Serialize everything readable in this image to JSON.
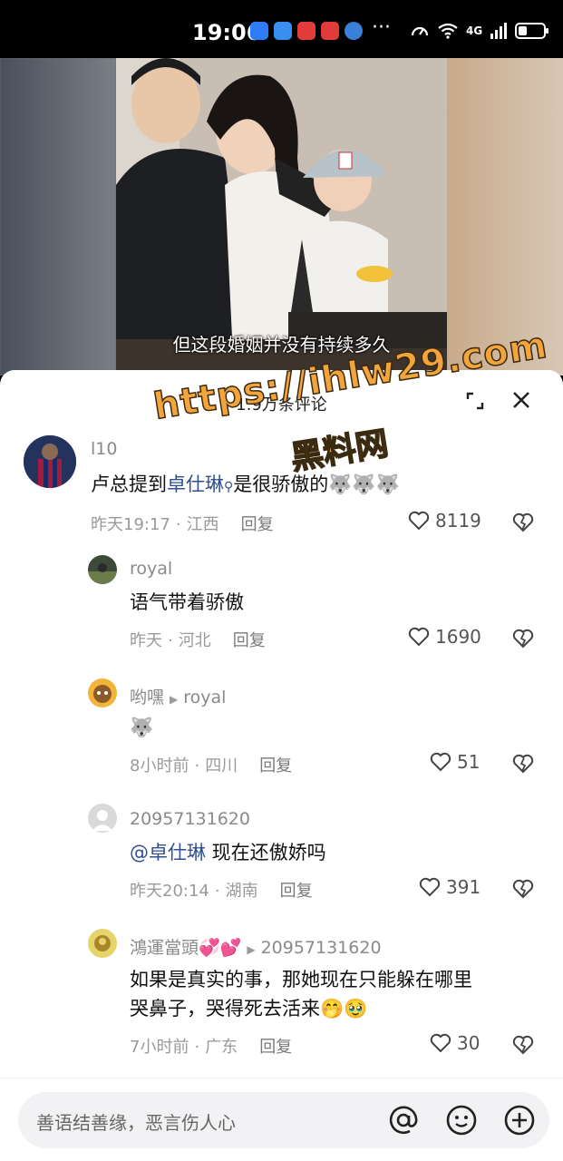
{
  "status_bar": {
    "time": "19:06",
    "signal_label": "4G"
  },
  "video": {
    "caption": "但这段婚姻并没有持续多久"
  },
  "sheet": {
    "title": "1.9万条评论"
  },
  "watermark": {
    "url": "https://ihlw29.com",
    "name": "黑料网"
  },
  "comments": [
    {
      "username": "l10",
      "text_before": "卢总提到",
      "mention": "卓仕琳",
      "text_after": "是很骄傲的🐺🐺🐺",
      "time": "昨天19:17",
      "location": "江西",
      "reply_label": "回复",
      "likes": "8119"
    },
    {
      "username": "royal",
      "text": "语气带着骄傲",
      "time": "昨天",
      "location": "河北",
      "reply_label": "回复",
      "likes": "1690"
    },
    {
      "username": "哟嘿",
      "reply_to": "royal",
      "text": "🐺",
      "time": "8小时前",
      "location": "四川",
      "reply_label": "回复",
      "likes": "51"
    },
    {
      "username": "20957131620",
      "mention": "@卓仕琳",
      "text_after": " 现在还傲娇吗",
      "time": "昨天20:14",
      "location": "湖南",
      "reply_label": "回复",
      "likes": "391"
    },
    {
      "username": "鴻運當頭💞💕",
      "reply_to": "20957131620",
      "text_line1": "如果是真实的事，那她现在只能躲在哪里",
      "text_line2": "哭鼻子，哭得死去活来🤭🥹",
      "time": "7小时前",
      "location": "广东",
      "reply_label": "回复",
      "likes": "30"
    }
  ],
  "input": {
    "placeholder": "善语结善缘，恶言伤人心"
  },
  "colors": {
    "mention": "#2f4f8f",
    "watermark": "#f3a43a"
  }
}
